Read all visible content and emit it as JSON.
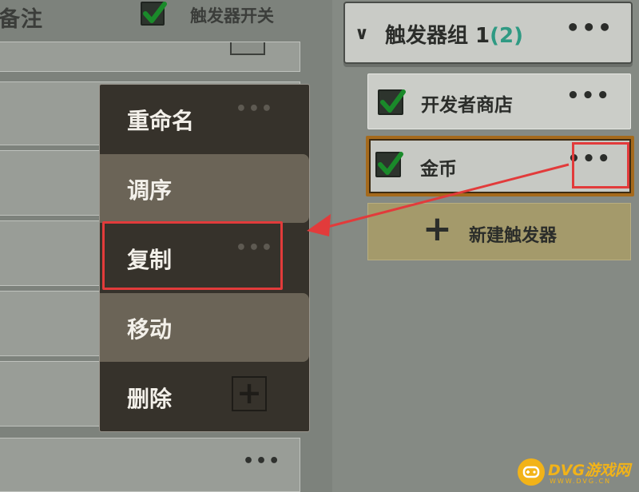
{
  "left_panel": {
    "column_note": "备注",
    "column_switch": "触发器开关",
    "switch_checked": true,
    "bottom_row_dots": "•••"
  },
  "context_menu": {
    "items": [
      {
        "label": "重命名"
      },
      {
        "label": "调序"
      },
      {
        "label": "复制"
      },
      {
        "label": "移动"
      },
      {
        "label": "删除"
      }
    ],
    "ghost_dots": "•••",
    "ghost_plus": "+"
  },
  "right_panel": {
    "group": {
      "chevron": "∨",
      "title": "触发器组 1",
      "count": "(2)",
      "more": "•••"
    },
    "triggers": [
      {
        "name": "开发者商店",
        "checked": true,
        "more": "•••"
      },
      {
        "name": "金币",
        "checked": true,
        "more": "•••"
      }
    ],
    "new_trigger": {
      "icon": "+",
      "label": "新建触发器"
    }
  },
  "annotations": {
    "highlight_color": "#e23b3b",
    "accent_count_color": "#2f9a83",
    "selected_border_color": "#a56a1c"
  },
  "watermark": {
    "text": "DVG游戏网",
    "sub": "WWW.DVG.CN"
  }
}
